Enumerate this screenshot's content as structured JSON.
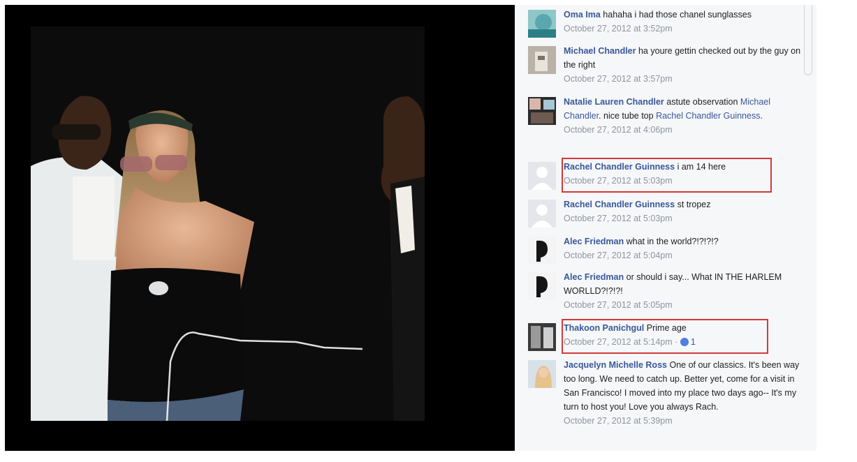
{
  "comments": [
    {
      "author": "Oma Ima",
      "text": "hahaha i had those chanel sunglasses",
      "time": "October 27, 2012 at 3:52pm"
    },
    {
      "author": "Michael Chandler",
      "text": "ha youre gettin checked out by the guy on the right",
      "time": "October 27, 2012 at 3:57pm"
    },
    {
      "author": "Natalie Lauren Chandler",
      "text_a": "astute observation",
      "mention_1": "Michael Chandler",
      "text_b": ". nice tube top",
      "mention_2": "Rachel Chandler Guinness",
      "text_c": ".",
      "time": "October 27, 2012 at 4:06pm"
    },
    {
      "author": "Rachel Chandler Guinness",
      "text": "i am 14 here",
      "time": "October 27, 2012 at 5:03pm"
    },
    {
      "author": "Rachel Chandler Guinness",
      "text": "st tropez",
      "time": "October 27, 2012 at 5:03pm"
    },
    {
      "author": "Alec Friedman",
      "text": "what in the world?!?!?!?",
      "time": "October 27, 2012 at 5:04pm"
    },
    {
      "author": "Alec Friedman",
      "text": "or should i say... What IN THE HARLEM WORLLD?!?!?!",
      "time": "October 27, 2012 at 5:05pm"
    },
    {
      "author": "Thakoon Panichgul",
      "text": "Prime age",
      "time": "October 27, 2012 at 5:14pm",
      "separator": "·",
      "likes": "1"
    },
    {
      "author": "Jacquelyn Michelle Ross",
      "text": "One of our classics. It's been way too long. We need to catch up. Better yet, come for a visit in San Francisco! I moved into my place two days ago-- It's my turn to host you! Love you always Rach.",
      "time": "October 27, 2012 at 5:39pm"
    }
  ],
  "colors": {
    "link": "#385898",
    "timestamp": "#8d949e",
    "highlight": "#d13a3a",
    "panel_bg": "#f6f7f9",
    "like": "#4f7de2"
  },
  "icons": {
    "like": "like-icon",
    "avatar_placeholder": "avatar-placeholder-icon"
  }
}
